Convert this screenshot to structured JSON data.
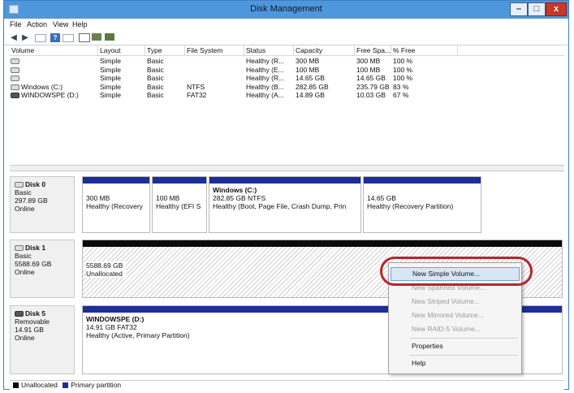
{
  "window": {
    "title": "Disk Management",
    "min": "–",
    "max": "□",
    "close": "x"
  },
  "menu": [
    "File",
    "Action",
    "View",
    "Help"
  ],
  "toolbar_icons": [
    "back-arrow-icon",
    "forward-arrow-icon",
    "console-tree-icon",
    "help-icon",
    "properties-view-icon",
    "refresh-icon",
    "properties-icon",
    "disk-settings-icon"
  ],
  "columns": [
    "Volume",
    "Layout",
    "Type",
    "File System",
    "Status",
    "Capacity",
    "Free Spa...",
    "% Free"
  ],
  "volumes": [
    {
      "volume": "",
      "layout": "Simple",
      "type": "Basic",
      "fs": "",
      "status": "Healthy (R...",
      "capacity": "300 MB",
      "free": "300 MB",
      "pct": "100 %"
    },
    {
      "volume": "",
      "layout": "Simple",
      "type": "Basic",
      "fs": "",
      "status": "Healthy (E...",
      "capacity": "100 MB",
      "free": "100 MB",
      "pct": "100 %"
    },
    {
      "volume": "",
      "layout": "Simple",
      "type": "Basic",
      "fs": "",
      "status": "Healthy (R...",
      "capacity": "14.65 GB",
      "free": "14.65 GB",
      "pct": "100 %"
    },
    {
      "volume": "Windows (C:)",
      "layout": "Simple",
      "type": "Basic",
      "fs": "NTFS",
      "status": "Healthy (B...",
      "capacity": "282.85 GB",
      "free": "235.79 GB",
      "pct": "83 %"
    },
    {
      "volume": "WINDOWSPE (D:)",
      "layout": "Simple",
      "type": "Basic",
      "fs": "FAT32",
      "status": "Healthy (A...",
      "capacity": "14.89 GB",
      "free": "10.03 GB",
      "pct": "67 %"
    }
  ],
  "disks": [
    {
      "name": "Disk 0",
      "kind": "Basic",
      "size": "297.89 GB",
      "state": "Online",
      "partitions": [
        {
          "title": "",
          "line1": "300 MB",
          "line2": "Healthy (Recovery"
        },
        {
          "title": "",
          "line1": "100 MB",
          "line2": "Healthy (EFI S"
        },
        {
          "title": "Windows (C:)",
          "line1": "282.85 GB NTFS",
          "line2": "Healthy (Boot, Page File, Crash Dump, Prin"
        },
        {
          "title": "",
          "line1": "14.65 GB",
          "line2": "Healthy (Recovery Partition)"
        }
      ]
    },
    {
      "name": "Disk 1",
      "kind": "Basic",
      "size": "5588.69 GB",
      "state": "Online",
      "partitions": [
        {
          "title": "",
          "line1": "5588.69 GB",
          "line2": "Unallocated"
        }
      ]
    },
    {
      "name": "Disk 5",
      "kind": "Removable",
      "size": "14.91 GB",
      "state": "Online",
      "partitions": [
        {
          "title": "WINDOWSPE (D:)",
          "line1": "14.91 GB FAT32",
          "line2": "Healthy (Active, Primary Partition)"
        }
      ]
    }
  ],
  "legend": [
    {
      "label": "Unallocated",
      "color": "#0a0a0a"
    },
    {
      "label": "Primary partition",
      "color": "#1d2e97"
    }
  ],
  "context_menu": [
    {
      "label": "New Simple Volume...",
      "enabled": true
    },
    {
      "label": "New Spanned Volume...",
      "enabled": false
    },
    {
      "label": "New Striped Volume...",
      "enabled": false
    },
    {
      "label": "New Mirrored Volume...",
      "enabled": false
    },
    {
      "label": "New RAID-5 Volume...",
      "enabled": false
    },
    {
      "label": "Properties",
      "enabled": true
    },
    {
      "label": "Help",
      "enabled": true
    }
  ],
  "colors": {
    "titlebar": "#4f97dc",
    "primary_partition": "#1d2e97",
    "unallocated": "#0a0a0a",
    "highlight_ring": "#b3272d"
  }
}
